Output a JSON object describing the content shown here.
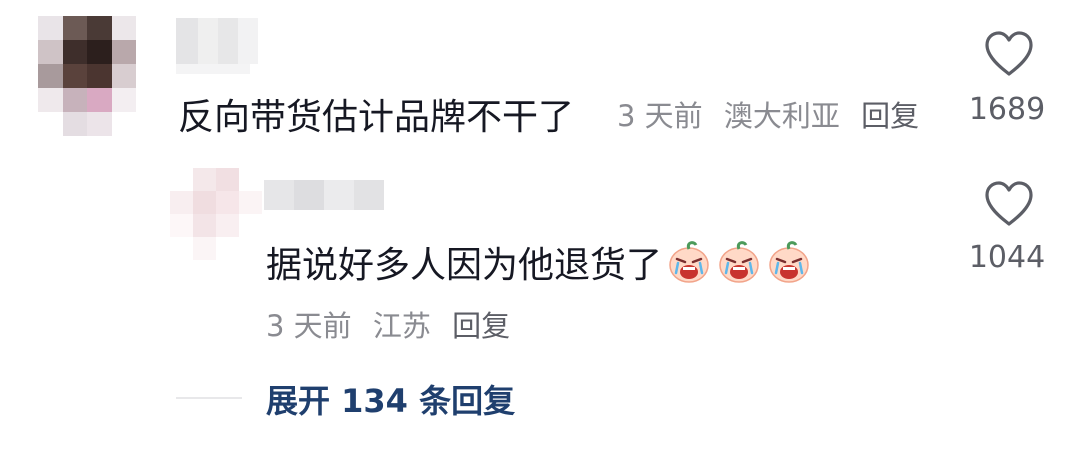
{
  "comment": {
    "text": "反向带货估计品牌不干了",
    "time": "3 天前",
    "location": "澳大利亚",
    "reply_label": "回复",
    "likes": "1689",
    "heart_icon": "heart-outline-icon"
  },
  "reply": {
    "text": "据说好多人因为他退货了",
    "emoji_icon": "crying-peach-emoji",
    "emoji_count": 3,
    "time": "3 天前",
    "location": "江苏",
    "reply_label": "回复",
    "likes": "1044",
    "heart_icon": "heart-outline-icon"
  },
  "expand_replies": {
    "label": "展开 134 条回复"
  },
  "colors": {
    "text": "#161823",
    "meta": "#8a8b91",
    "link": "#1f3f6e",
    "like_count": "#5c5e66"
  }
}
